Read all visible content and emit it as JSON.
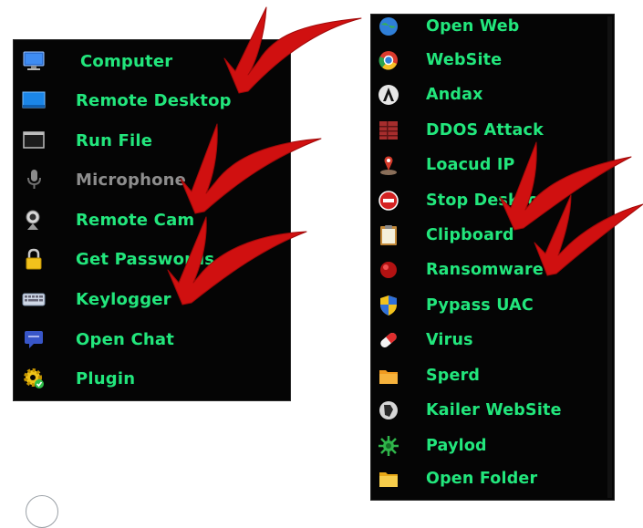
{
  "left_menu": {
    "items": [
      {
        "label": "Computer",
        "icon": "computer-monitor-icon",
        "enabled": true
      },
      {
        "label": "Remote Desktop",
        "icon": "remote-desktop-icon",
        "enabled": true
      },
      {
        "label": "Run File",
        "icon": "run-file-icon",
        "enabled": true
      },
      {
        "label": "Microphone",
        "icon": "microphone-icon",
        "enabled": false
      },
      {
        "label": "Remote Cam",
        "icon": "webcam-icon",
        "enabled": true
      },
      {
        "label": "Get Passwords",
        "icon": "padlock-icon",
        "enabled": true
      },
      {
        "label": "Keylogger",
        "icon": "keyboard-icon",
        "enabled": true
      },
      {
        "label": "Open Chat",
        "icon": "chat-icon",
        "enabled": true
      },
      {
        "label": "Plugin",
        "icon": "gear-plugin-icon",
        "enabled": true
      }
    ]
  },
  "right_menu": {
    "items": [
      {
        "label": "Open Web",
        "icon": "globe-icon"
      },
      {
        "label": "WebSite",
        "icon": "chrome-icon"
      },
      {
        "label": "Andax",
        "icon": "andax-icon"
      },
      {
        "label": "DDOS Attack",
        "icon": "ddos-icon"
      },
      {
        "label": "Loacud IP",
        "icon": "location-pin-icon"
      },
      {
        "label": "Stop DeskTop",
        "icon": "stop-desktop-icon"
      },
      {
        "label": "Clipboard",
        "icon": "clipboard-icon"
      },
      {
        "label": "Ransomware",
        "icon": "ransomware-icon"
      },
      {
        "label": "Pypass UAC",
        "icon": "uac-shield-icon"
      },
      {
        "label": "Virus",
        "icon": "pill-icon"
      },
      {
        "label": "Sperd",
        "icon": "spread-folder-icon"
      },
      {
        "label": "Kailer WebSite",
        "icon": "kailer-icon"
      },
      {
        "label": "Paylod",
        "icon": "payload-icon"
      },
      {
        "label": "Open Folder",
        "icon": "folder-icon"
      }
    ]
  },
  "colors": {
    "menu_bg": "#050505",
    "label_green": "#22e67c",
    "label_disabled": "#8d8d8d",
    "arrow_red": "#d01010"
  }
}
